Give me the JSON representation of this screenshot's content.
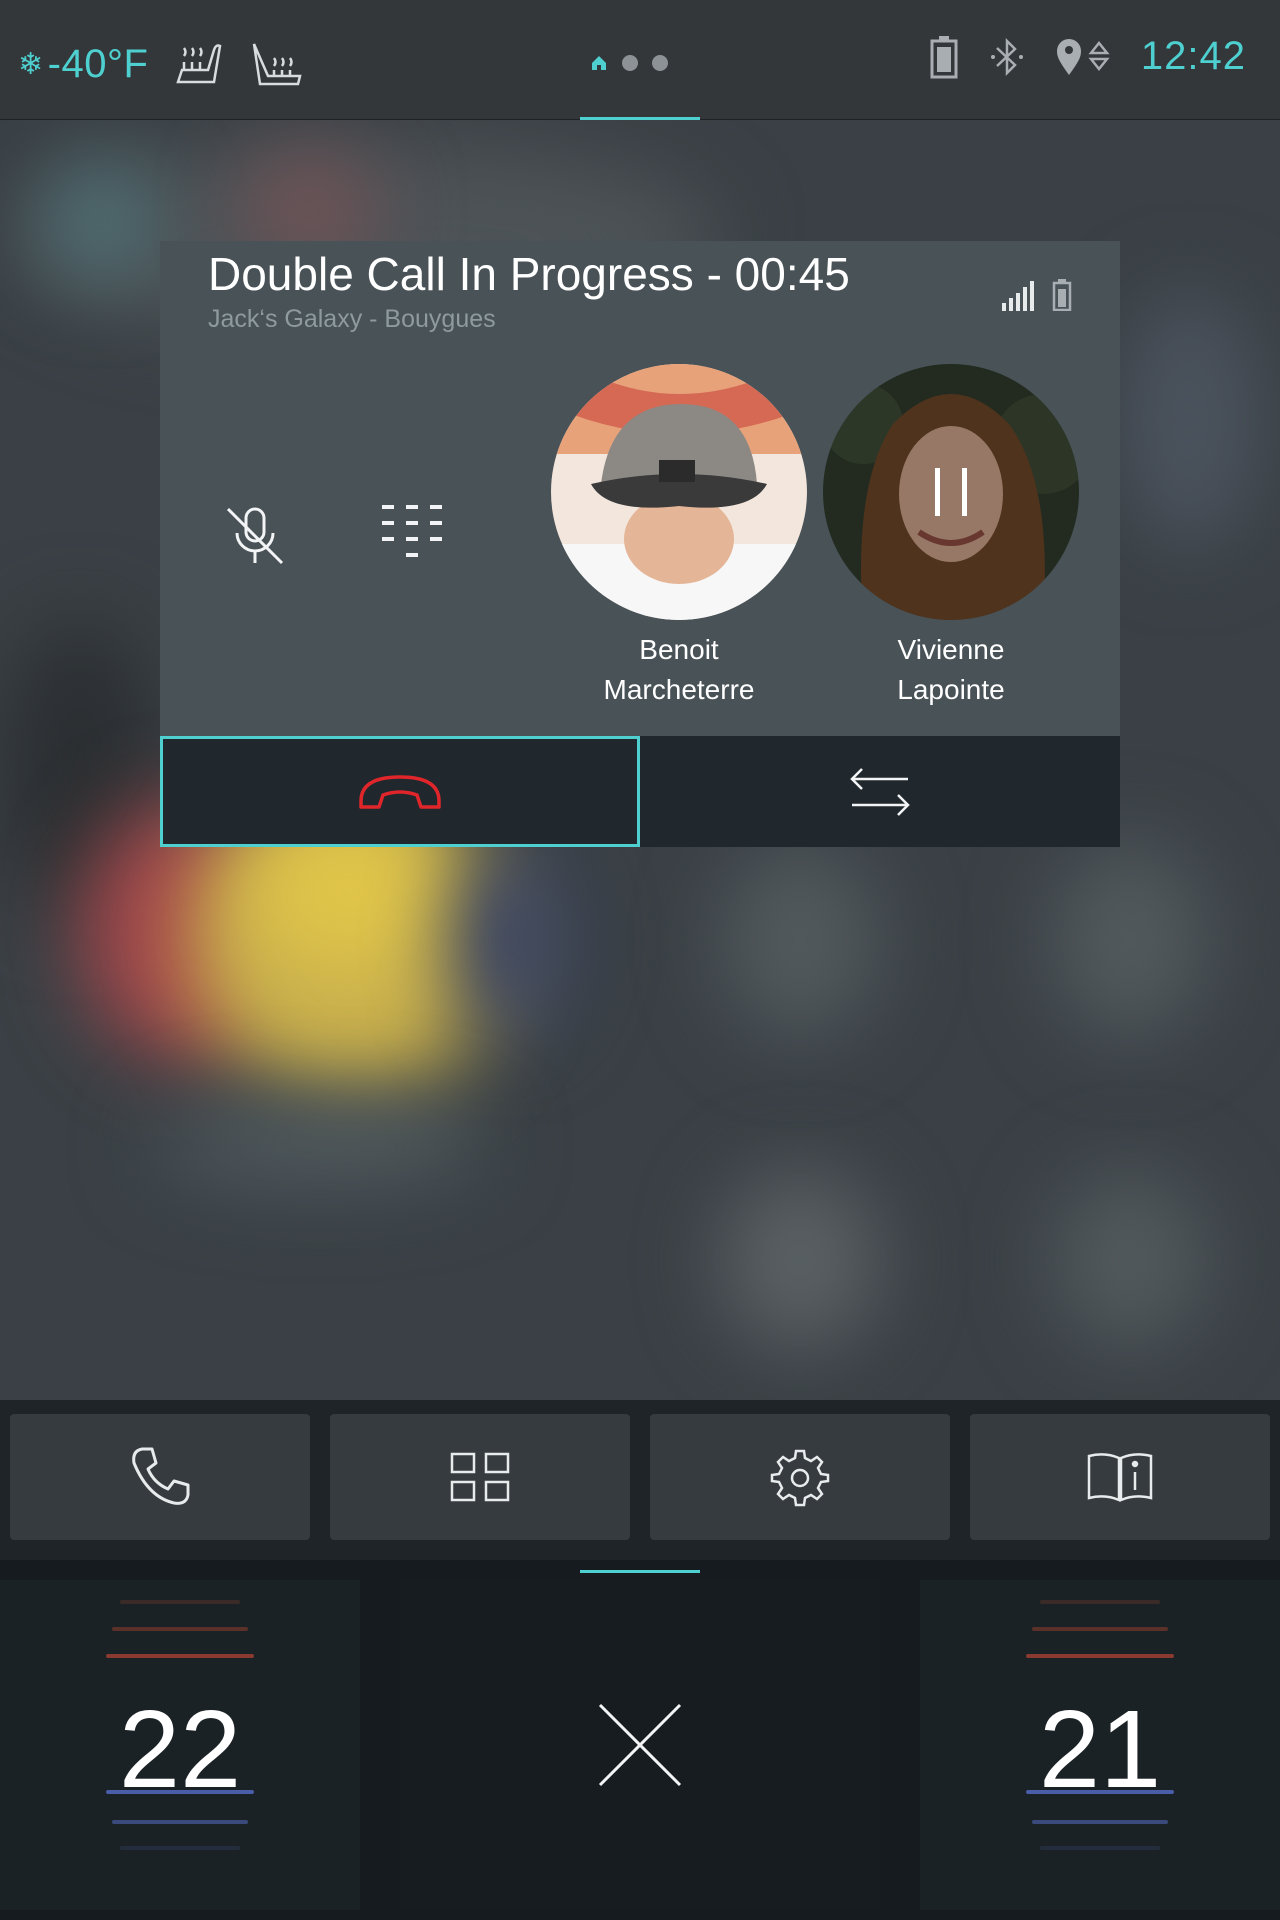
{
  "status_bar": {
    "outside_temp": "-40°F",
    "time": "12:42",
    "pager_pages": 3,
    "pager_active": 0
  },
  "call": {
    "title": "Double Call In Progress - 00:45",
    "subtitle": "Jack‘s Galaxy - Bouygues",
    "callers": [
      {
        "first": "Benoit",
        "last": "Marcheterre",
        "status": "active"
      },
      {
        "first": "Vivienne",
        "last": "Lapointe",
        "status": "on-hold"
      }
    ]
  },
  "dock": {
    "items": [
      "phone",
      "apps",
      "settings",
      "manual"
    ]
  },
  "climate": {
    "left_temp": "22",
    "right_temp": "21"
  },
  "colors": {
    "accent": "#4fd0d0",
    "hangup": "#e0252b",
    "heat": "#8a3a2e",
    "cool": "#4a5da8"
  }
}
